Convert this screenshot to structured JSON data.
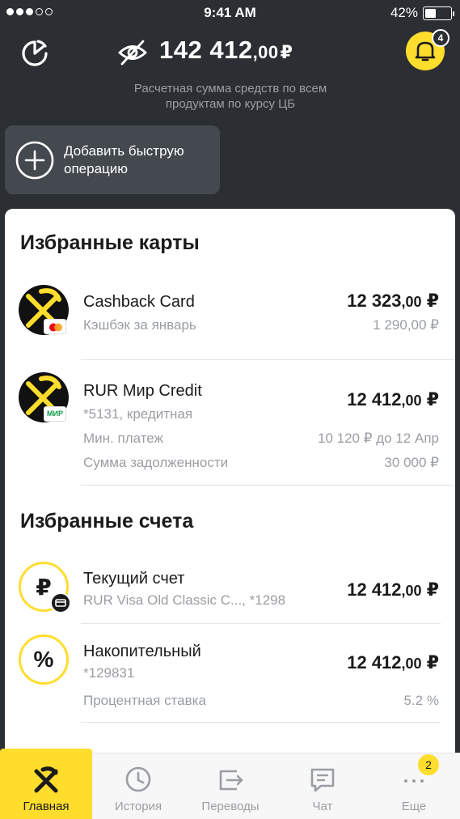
{
  "status_bar": {
    "time": "9:41 AM",
    "battery": "42%",
    "battery_level": 0.42,
    "signal_bars_filled": 3,
    "signal_bars_total": 5
  },
  "header": {
    "balance_main": "142 412",
    "balance_kop": ",00",
    "currency": "₽",
    "note": "Расчетная сумма средств по всем продуктам по курсу ЦБ",
    "notifications_count": "4",
    "icons": [
      "pie-chart-icon",
      "eye-off-icon",
      "bell-icon"
    ]
  },
  "quick_op": {
    "label": "Добавить быструю операцию",
    "icon": "plus-circle-icon"
  },
  "favorite_cards": {
    "title": "Избранные карты",
    "items": [
      {
        "name": "Cashback Card",
        "sub": "Кэшбэк за январь",
        "amount_main": "12 323",
        "amount_kop": ",00",
        "currency": "₽",
        "amount_sub": "1 290,00 ₽",
        "payment_system": "mastercard-icon"
      },
      {
        "name": "RUR Мир Credit",
        "sub": "*5131,   кредитная",
        "amount_main": "12 412",
        "amount_kop": ",00",
        "currency": "₽",
        "min_payment_label": "Мин. платеж",
        "min_payment_value": "10 120 ₽ до 12 Апр",
        "debt_label": "Сумма задолженности",
        "debt_value": "30 000 ₽",
        "payment_system": "mir-icon",
        "payment_system_text": "МИР"
      }
    ]
  },
  "favorite_accounts": {
    "title": "Избранные счета",
    "items": [
      {
        "name": "Текущий счет",
        "sub": "RUR Visa Old Classic C..., *1298",
        "amount_main": "12 412",
        "amount_kop": ",00",
        "currency": "₽",
        "glyph": "₽"
      },
      {
        "name": "Накопительный",
        "sub": "*129831",
        "amount_main": "12 412",
        "amount_kop": ",00",
        "currency": "₽",
        "rate_label": "Процентная ставка",
        "rate_value": "5.2 %",
        "glyph": "%"
      }
    ]
  },
  "tabs": [
    {
      "label": "Главная",
      "icon": "raiffeisen-logo-icon",
      "active": true
    },
    {
      "label": "История",
      "icon": "clock-icon",
      "active": false
    },
    {
      "label": "Переводы",
      "icon": "transfer-icon",
      "active": false
    },
    {
      "label": "Чат",
      "icon": "chat-icon",
      "active": false
    },
    {
      "label": "Еще",
      "icon": "more-icon",
      "active": false,
      "badge": "2"
    }
  ],
  "colors": {
    "brand_yellow": "#ffdd2d",
    "dark_bg": "#2b2f33",
    "muted_text": "#9a9ea3"
  }
}
